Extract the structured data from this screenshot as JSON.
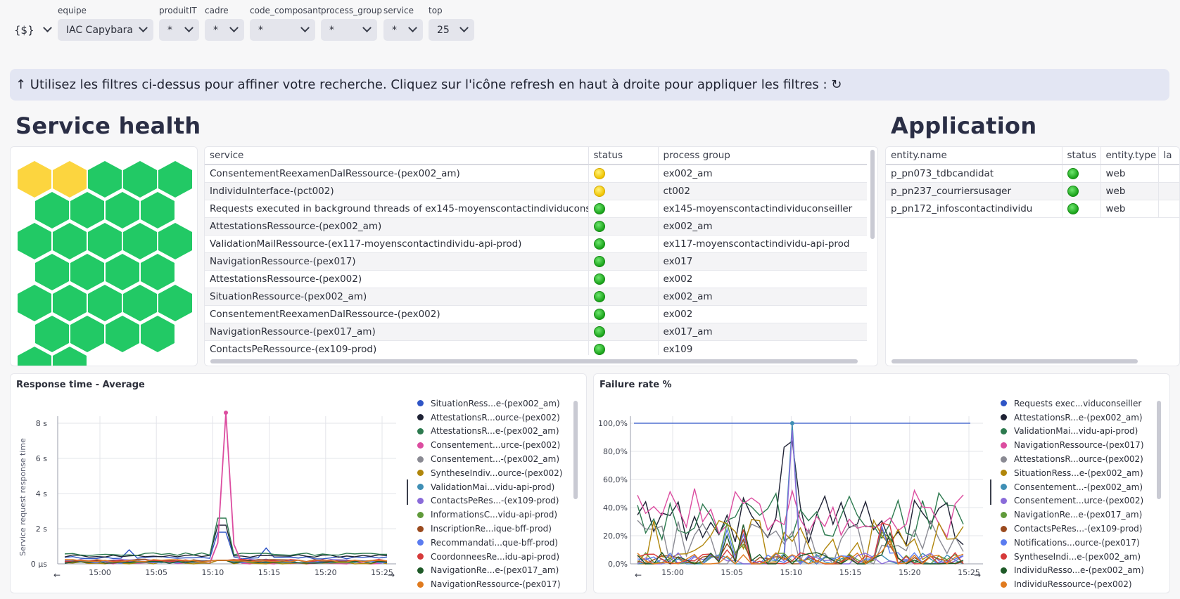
{
  "filters": {
    "variables_button": "{$}",
    "items": [
      {
        "label": "equipe",
        "value": "IAC Capybara"
      },
      {
        "label": "produitIT",
        "value": "*"
      },
      {
        "label": "cadre",
        "value": "*"
      },
      {
        "label": "code_composant",
        "value": "*"
      },
      {
        "label": "process_group",
        "value": "*"
      },
      {
        "label": "service",
        "value": "*"
      },
      {
        "label": "top",
        "value": "25"
      }
    ]
  },
  "banner": "↑ Utilisez les filtres ci-dessus pour affiner votre recherche. Cliquez sur l'icône refresh en haut à droite pour appliquer les filtres : ↻",
  "service_health": {
    "title": "Service health",
    "honeycomb": [
      "warning",
      "warning",
      "ok",
      "ok",
      "ok",
      "ok",
      "ok",
      "ok",
      "ok",
      "ok",
      "ok",
      "ok",
      "ok",
      "ok",
      "ok",
      "ok",
      "ok",
      "ok",
      "ok",
      "ok",
      "ok",
      "ok",
      "ok",
      "ok",
      "ok",
      "ok",
      "ok",
      "ok",
      "ok"
    ],
    "colors": {
      "ok": "#22c965",
      "warning": "#fcd53f",
      "status_green": "#22b322",
      "status_yellow": "#f5cc00"
    },
    "columns": [
      "service",
      "status",
      "process group"
    ],
    "rows": [
      {
        "service": "ConsentementReexamenDalRessource-(pex002_am)",
        "status": "yellow",
        "pg": "ex002_am"
      },
      {
        "service": "IndividuInterface-(pct002)",
        "status": "yellow",
        "pg": "ct002"
      },
      {
        "service": "Requests executed in background threads of ex145-moyenscontactindividuconseiller",
        "status": "green",
        "pg": "ex145-moyenscontactindividuconseiller"
      },
      {
        "service": "AttestationsRessource-(pex002_am)",
        "status": "green",
        "pg": "ex002_am"
      },
      {
        "service": "ValidationMailRessource-(ex117-moyenscontactindividu-api-prod)",
        "status": "green",
        "pg": "ex117-moyenscontactindividu-api-prod"
      },
      {
        "service": "NavigationRessource-(pex017)",
        "status": "green",
        "pg": "ex017"
      },
      {
        "service": "AttestationsRessource-(pex002)",
        "status": "green",
        "pg": "ex002"
      },
      {
        "service": "SituationRessource-(pex002_am)",
        "status": "green",
        "pg": "ex002_am"
      },
      {
        "service": "ConsentementReexamenDalRessource-(pex002)",
        "status": "green",
        "pg": "ex002"
      },
      {
        "service": "NavigationRessource-(pex017_am)",
        "status": "green",
        "pg": "ex017_am"
      },
      {
        "service": "ContactsPeRessource-(ex109-prod)",
        "status": "green",
        "pg": "ex109"
      }
    ]
  },
  "application": {
    "title": "Application",
    "columns": [
      "entity.name",
      "status",
      "entity.type",
      "la"
    ],
    "rows": [
      {
        "name": "p_pn073_tdbcandidat",
        "status": "green",
        "type": "web"
      },
      {
        "name": "p_pn237_courriersusager",
        "status": "green",
        "type": "web"
      },
      {
        "name": "p_pn172_infoscontactindividu",
        "status": "green",
        "type": "web"
      }
    ]
  },
  "response_chart": {
    "title": "Response time - Average",
    "ylabel": "Service request response time",
    "yticks": [
      "8 s",
      "6 s",
      "4 s",
      "2 s",
      "0 µs"
    ],
    "xticks": [
      "15:00",
      "15:05",
      "15:10",
      "15:15",
      "15:20",
      "15:25"
    ],
    "legend": [
      {
        "name": "SituationRess...e-(pex002_am)",
        "color": "#2f55c6"
      },
      {
        "name": "AttestationsR...ource-(pex002)",
        "color": "#1f2235"
      },
      {
        "name": "AttestationsR...e-(pex002_am)",
        "color": "#2d7a4f"
      },
      {
        "name": "Consentement...urce-(pex002)",
        "color": "#dc4da0"
      },
      {
        "name": "Consentement...-(pex002_am)",
        "color": "#8a8a93"
      },
      {
        "name": "SyntheseIndiv...ource-(pex002)",
        "color": "#b0860b"
      },
      {
        "name": "ValidationMai...vidu-api-prod)",
        "color": "#3f8fb5"
      },
      {
        "name": "ContactsPeRes...-(ex109-prod)",
        "color": "#8a6bd9"
      },
      {
        "name": "InformationsC...vidu-api-prod)",
        "color": "#5f9a3a"
      },
      {
        "name": "InscriptionRe...ique-bff-prod)",
        "color": "#9a4a1e"
      },
      {
        "name": "Recommandati...que-bff-prod)",
        "color": "#5b7cf0"
      },
      {
        "name": "CoordonneesRe...idu-api-prod)",
        "color": "#d63a3a"
      },
      {
        "name": "NavigationRe...e-(pex017_am)",
        "color": "#1f5a28"
      },
      {
        "name": "NavigationRessource-(pex017)",
        "color": "#e07b1f"
      }
    ]
  },
  "failure_chart": {
    "title": "Failure rate %",
    "yticks": [
      "100,0%",
      "80,0%",
      "60,0%",
      "40,0%",
      "20,0%",
      "0,0%"
    ],
    "xticks": [
      "15:00",
      "15:05",
      "15:10",
      "15:15",
      "15:20",
      "15:25"
    ],
    "legend": [
      {
        "name": "Requests exec...viduconseiller",
        "color": "#2f55c6"
      },
      {
        "name": "AttestationsR...e-(pex002_am)",
        "color": "#1f2235"
      },
      {
        "name": "ValidationMai...vidu-api-prod)",
        "color": "#2d7a4f"
      },
      {
        "name": "NavigationRessource-(pex017)",
        "color": "#dc4da0"
      },
      {
        "name": "AttestationsR...ource-(pex002)",
        "color": "#8a8a93"
      },
      {
        "name": "SituationRess...e-(pex002_am)",
        "color": "#b0860b"
      },
      {
        "name": "Consentement...-(pex002_am)",
        "color": "#3f8fb5"
      },
      {
        "name": "Consentement...urce-(pex002)",
        "color": "#8a6bd9"
      },
      {
        "name": "NavigationRe...e-(pex017_am)",
        "color": "#5f9a3a"
      },
      {
        "name": "ContactsPeRes...-(ex109-prod)",
        "color": "#9a4a1e"
      },
      {
        "name": "Notifications...ource-(pex017)",
        "color": "#5b7cf0"
      },
      {
        "name": "SyntheseIndi...e-(pex002_am)",
        "color": "#d63a3a"
      },
      {
        "name": "IndividuResso...e-(pex002_am)",
        "color": "#1f5a28"
      },
      {
        "name": "IndividuRessource-(pex002)",
        "color": "#e07b1f"
      }
    ]
  }
}
